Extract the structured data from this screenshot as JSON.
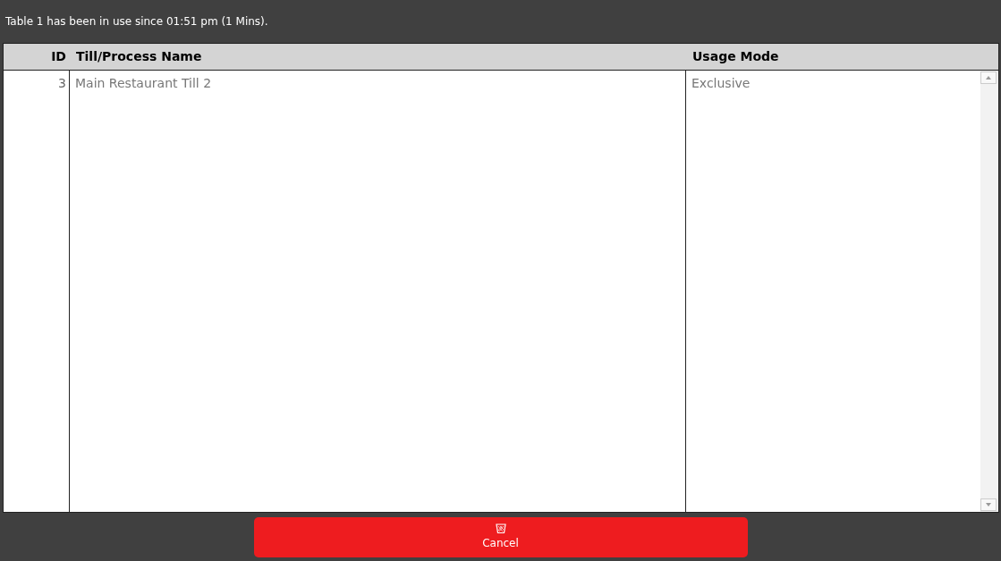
{
  "message": "Table 1 has been in use since 01:51 pm (1 Mins).",
  "table": {
    "columns": [
      "ID",
      "Till/Process Name",
      "Usage Mode"
    ],
    "rows": [
      {
        "id": "3",
        "name": "Main Restaurant Till 2",
        "usage_mode": "Exclusive"
      }
    ]
  },
  "buttons": [
    {
      "label": "Cancel",
      "kind": "cancel"
    }
  ]
}
